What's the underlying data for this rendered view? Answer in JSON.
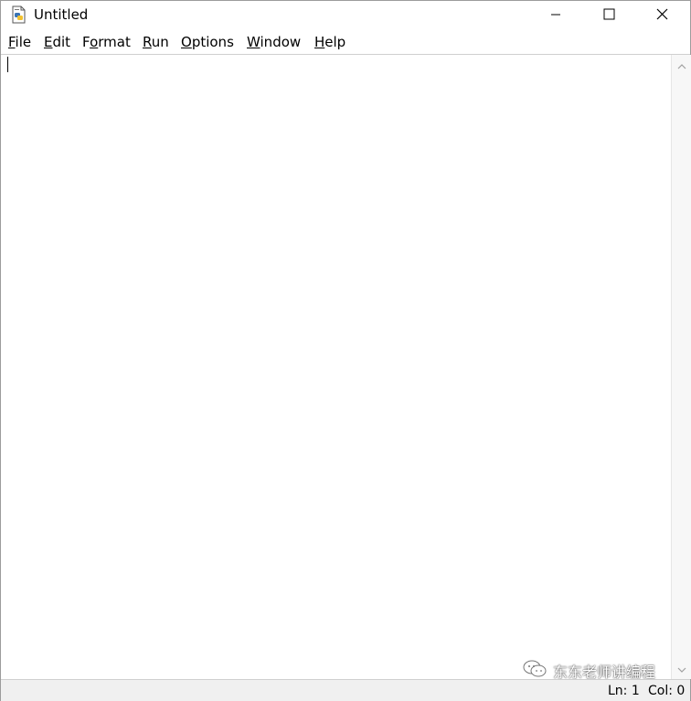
{
  "window": {
    "title": "Untitled",
    "app_icon": "python-file-icon"
  },
  "window_controls": [
    "minimize-icon",
    "maximize-icon",
    "close-icon"
  ],
  "menu": [
    {
      "mnemonic": "F",
      "rest": "ile"
    },
    {
      "mnemonic": "E",
      "rest": "dit"
    },
    {
      "pre": "F",
      "mnemonic": "o",
      "rest": "rmat"
    },
    {
      "mnemonic": "R",
      "rest": "un"
    },
    {
      "mnemonic": "O",
      "rest": "ptions"
    },
    {
      "mnemonic": "W",
      "rest": "indow"
    },
    {
      "mnemonic": "H",
      "rest": "elp"
    }
  ],
  "editor": {
    "content": ""
  },
  "watermark": {
    "text": "东东老师讲编程",
    "icon": "wechat-icon"
  },
  "status": {
    "ln": "Ln: 1",
    "col": "Col: 0"
  }
}
